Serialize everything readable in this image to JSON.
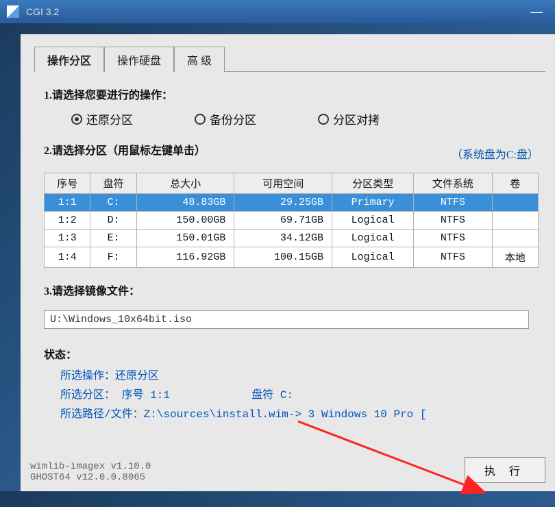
{
  "window": {
    "title": "CGI 3.2"
  },
  "tabs": [
    {
      "label": "操作分区",
      "active": true
    },
    {
      "label": "操作硬盘",
      "active": false
    },
    {
      "label": "高 级",
      "active": false
    }
  ],
  "step1": {
    "label": "1.请选择您要进行的操作：",
    "options": [
      {
        "label": "还原分区",
        "checked": true
      },
      {
        "label": "备份分区",
        "checked": false
      },
      {
        "label": "分区对拷",
        "checked": false
      }
    ]
  },
  "step2": {
    "label": "2.请选择分区（用鼠标左键单击）",
    "hint": "（系统盘为C:盘）",
    "headers": [
      "序号",
      "盘符",
      "总大小",
      "可用空间",
      "分区类型",
      "文件系统",
      "卷"
    ],
    "rows": [
      {
        "no": "1:1",
        "drv": "C:",
        "total": "48.83GB",
        "free": "29.25GB",
        "ptype": "Primary",
        "fs": "NTFS",
        "vol": "",
        "sel": true
      },
      {
        "no": "1:2",
        "drv": "D:",
        "total": "150.00GB",
        "free": "69.71GB",
        "ptype": "Logical",
        "fs": "NTFS",
        "vol": "",
        "sel": false
      },
      {
        "no": "1:3",
        "drv": "E:",
        "total": "150.01GB",
        "free": "34.12GB",
        "ptype": "Logical",
        "fs": "NTFS",
        "vol": "",
        "sel": false
      },
      {
        "no": "1:4",
        "drv": "F:",
        "total": "116.92GB",
        "free": "100.15GB",
        "ptype": "Logical",
        "fs": "NTFS",
        "vol": "本地",
        "sel": false
      }
    ]
  },
  "step3": {
    "label": "3.请选择镜像文件：",
    "path": "U:\\Windows_10x64bit.iso"
  },
  "status": {
    "title": "状态：",
    "line1": "所选操作：还原分区",
    "line2a": "所选分区：  序号 1:1",
    "line2b": "盘符 C:",
    "line3": "所选路径/文件：Z:\\sources\\install.wim-> 3  Windows 10 Pro ["
  },
  "footer": {
    "line1": "wimlib-imagex v1.10.0",
    "line2": "GHOST64 v12.0.0.8065",
    "exec": "执 行"
  }
}
